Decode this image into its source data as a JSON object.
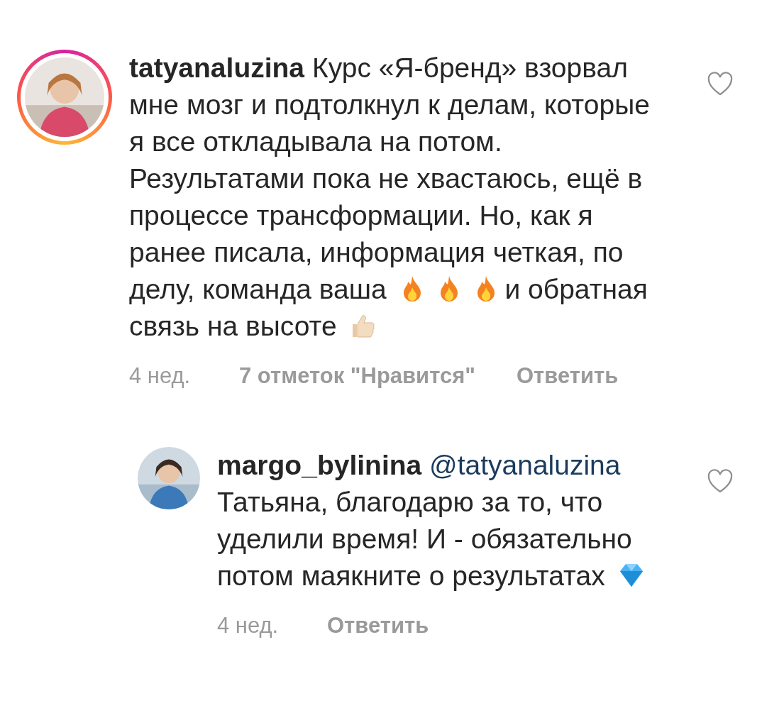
{
  "comments": [
    {
      "avatar": {
        "kind": "picture",
        "story_ring": true
      },
      "username": "tatyanaluzina",
      "liked": false,
      "segments": [
        {
          "kind": "text",
          "text": "Курс «Я-бренд» взорвал мне мозг и подтолкнул к делам, которые я все откладывала на потом. Результатами пока не хвастаюсь, ещё в процессе трансформации. Но, как я ранее писала, информация четкая, по делу, команда ваша"
        },
        {
          "kind": "fire"
        },
        {
          "kind": "fire"
        },
        {
          "kind": "fire"
        },
        {
          "kind": "text",
          "text": "и обратная связь на высоте"
        },
        {
          "kind": "thumbs"
        }
      ],
      "time": "4 нед.",
      "likes": "7 отметок \"Нравится\"",
      "reply_label": "Ответить",
      "replies": [
        {
          "avatar": {
            "kind": "picture",
            "story_ring": false
          },
          "username": "margo_bylinina",
          "mention": "@tatyanaluzina",
          "liked": false,
          "segments": [
            {
              "kind": "text",
              "text": "Татьяна, благодарю за то, что уделили время! И - обязательно потом маякните о результатах"
            },
            {
              "kind": "gem"
            }
          ],
          "time": "4 нед.",
          "reply_label": "Ответить"
        }
      ]
    }
  ]
}
